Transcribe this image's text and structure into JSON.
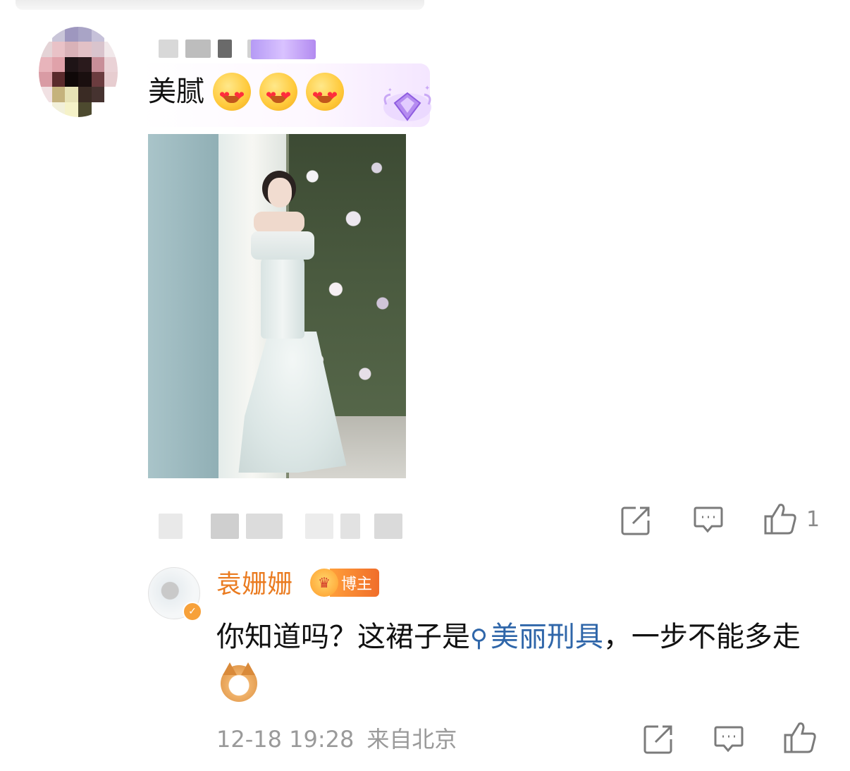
{
  "comment": {
    "text": "美腻",
    "emoji_icons": [
      "heart-eyes-emoji",
      "heart-eyes-emoji",
      "heart-eyes-emoji"
    ],
    "like_count": "1"
  },
  "reply": {
    "username": "袁姗姗",
    "badge_label": "博主",
    "text_before": "你知道吗？这裙子是",
    "topic_link": "美丽刑具",
    "text_after": "，一步不能多走",
    "emoji_icon": "cat-emoji",
    "date": "12-18 19:28",
    "location": "来自北京"
  },
  "colors": {
    "username": "#ea7b20",
    "link": "#2f66a9",
    "meta_gray": "#9a9a9a",
    "icon_gray": "#7b7b7b"
  }
}
